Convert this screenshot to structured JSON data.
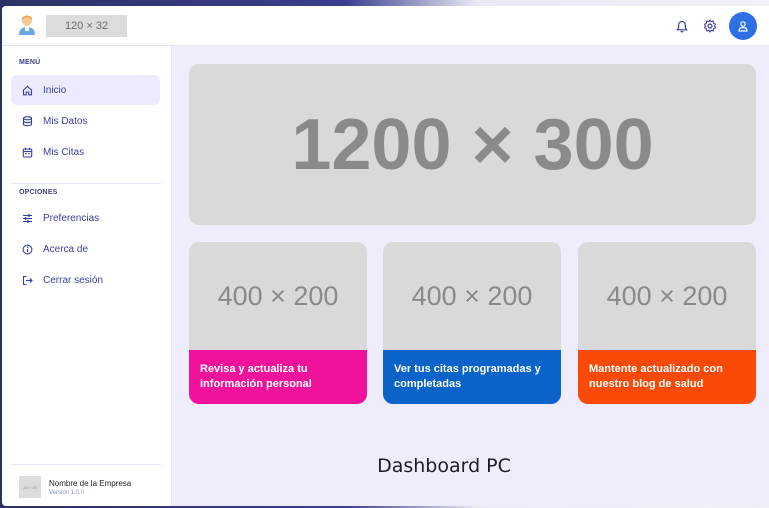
{
  "topbar": {
    "logo_placeholder": "120 × 32",
    "icons": [
      "bell-icon",
      "gear-icon",
      "user-icon"
    ]
  },
  "sidebar": {
    "section_menu": "MENÚ",
    "menu_items": [
      {
        "label": "Inicio",
        "icon": "home-icon",
        "active": true
      },
      {
        "label": "Mis Datos",
        "icon": "database-icon",
        "active": false
      },
      {
        "label": "Mis Citas",
        "icon": "calendar-icon",
        "active": false
      }
    ],
    "section_options": "OPCIONES",
    "option_items": [
      {
        "label": "Preferencias",
        "icon": "sliders-icon"
      },
      {
        "label": "Acerca de",
        "icon": "info-icon"
      },
      {
        "label": "Cerrar sesión",
        "icon": "logout-icon"
      }
    ],
    "company": {
      "logo_text": "20 × 20",
      "name": "Nombre de la Empresa",
      "version": "Versión 1.0.0"
    }
  },
  "main": {
    "hero_placeholder": "1200 × 300",
    "cards": [
      {
        "placeholder": "400 × 200",
        "text": "Revisa y actualiza tu información personal",
        "color": "#f0129a"
      },
      {
        "placeholder": "400 × 200",
        "text": "Ver tus citas programadas y completadas",
        "color": "#0a63c9"
      },
      {
        "placeholder": "400 × 200",
        "text": "Mantente actualizado con nuestro blog de salud",
        "color": "#fb4a07"
      }
    ]
  },
  "caption": "Dashboard PC",
  "colors": {
    "accent": "#2f6fe6",
    "sidebar_text": "#3b3f9c",
    "main_bg": "#efedfb"
  }
}
